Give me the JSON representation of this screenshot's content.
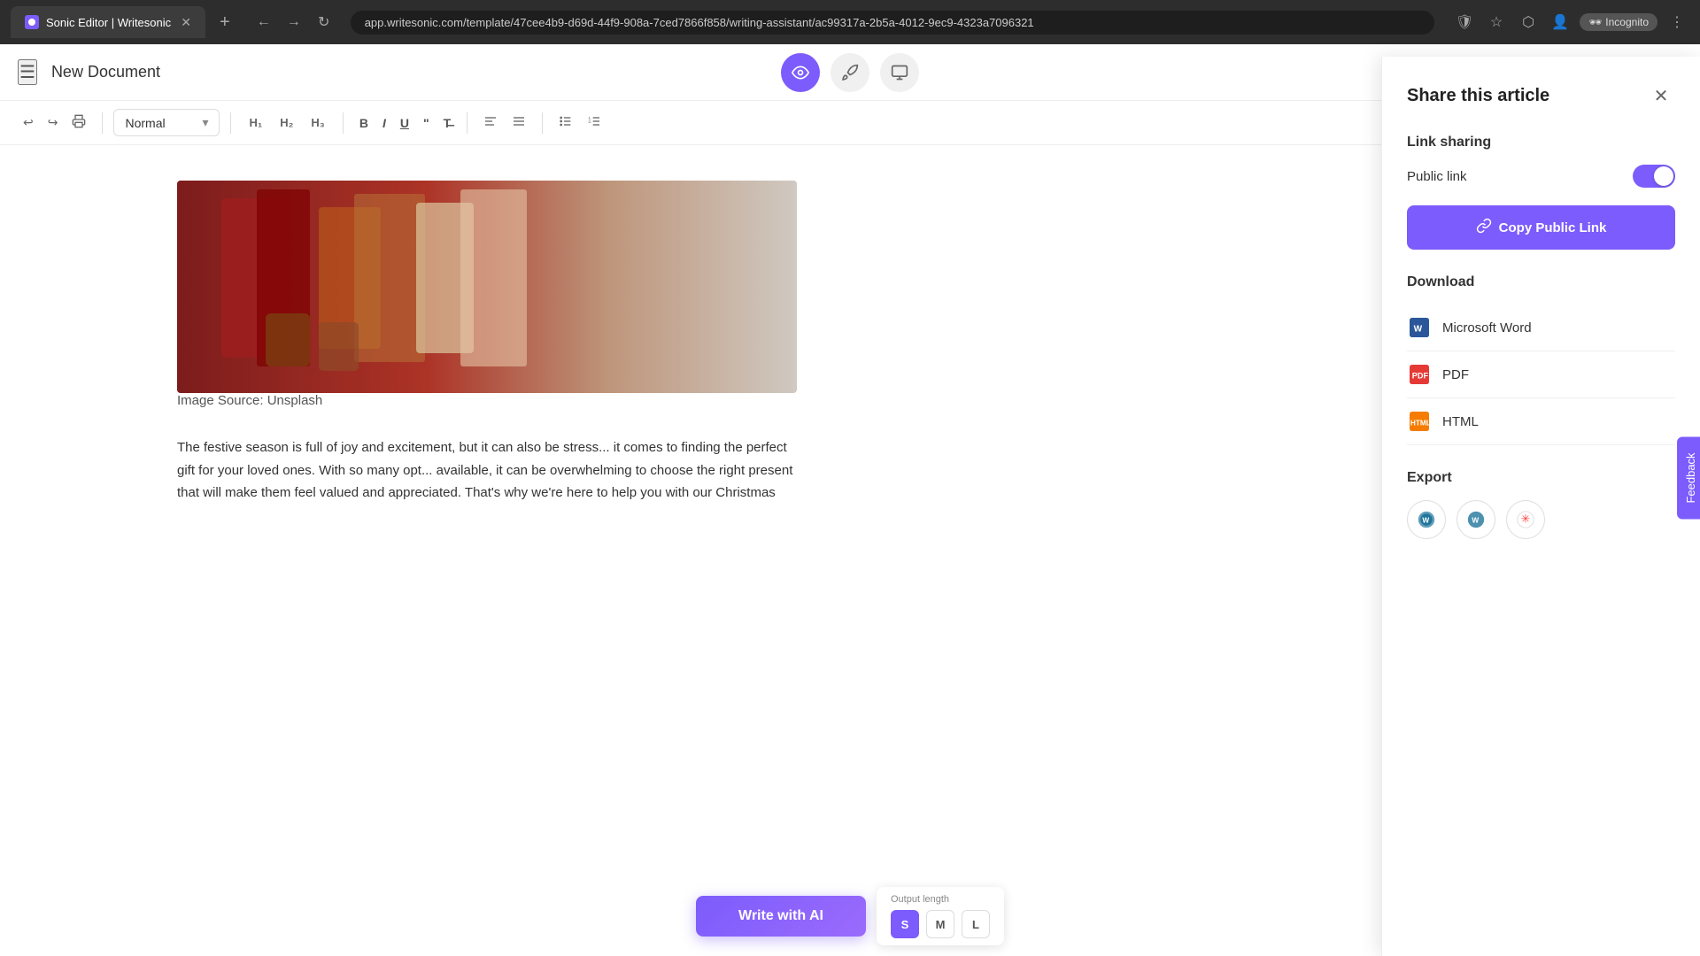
{
  "browser": {
    "tab_title": "Sonic Editor | Writesonic",
    "url": "app.writesonic.com/template/47cee4b9-d69d-44f9-908a-7ced7866f858/writing-assistant/ac99317a-2b5a-4012-9ec9-4323a7096321",
    "incognito_label": "Incognito"
  },
  "toolbar": {
    "menu_icon": "☰",
    "doc_title": "New Document",
    "share_icon": "↑",
    "close_icon": "✕",
    "record_icon": "⊙"
  },
  "editor_toolbar": {
    "undo_icon": "↩",
    "redo_icon": "↪",
    "print_icon": "🖨",
    "style_label": "Normal",
    "h1_label": "H₁",
    "h2_label": "H₂",
    "h3_label": "H₃",
    "bold_label": "B",
    "italic_label": "I",
    "underline_label": "U",
    "quote_label": "❝❞",
    "clear_label": "T̶"
  },
  "content": {
    "image_source": "Image Source: Unsplash",
    "article_text": "The festive season is full of joy and excitement, but it can also be stress... it comes to finding the perfect gift for your loved ones. With so many opt... available, it can be overwhelming to choose the right present that will make them feel valued and appreciated. That's why we're here to help you with our Christmas"
  },
  "bottom_bar": {
    "write_ai_label": "Write with AI",
    "output_length_label": "Output length",
    "size_s": "S",
    "size_m": "M",
    "size_l": "L"
  },
  "share_panel": {
    "title": "Share this article",
    "link_sharing_label": "Link sharing",
    "public_link_label": "Public link",
    "toggle_on": true,
    "copy_button_label": "Copy Public Link",
    "copy_icon": "🔗",
    "download_label": "Download",
    "items": [
      {
        "id": "word",
        "label": "Microsoft Word",
        "icon": "W"
      },
      {
        "id": "pdf",
        "label": "PDF",
        "icon": "📄"
      },
      {
        "id": "html",
        "label": "HTML",
        "icon": "◈"
      }
    ],
    "export_label": "Export",
    "export_icons": [
      {
        "id": "wp1",
        "icon": "W",
        "label": "WordPress"
      },
      {
        "id": "wp2",
        "icon": "W",
        "label": "WordPress Alt"
      },
      {
        "id": "star",
        "icon": "✳",
        "label": "Star Export"
      }
    ]
  },
  "feedback": {
    "label": "Feedback"
  }
}
